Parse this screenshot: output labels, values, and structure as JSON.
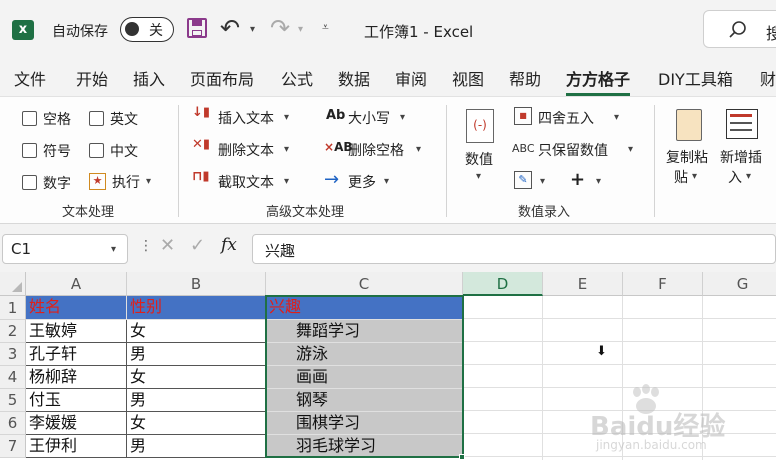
{
  "titlebar": {
    "autosave_label": "自动保存",
    "autosave_state": "关",
    "doc_title": "工作簿1 - Excel",
    "search_partial": "搜"
  },
  "tabs": [
    "文件",
    "开始",
    "插入",
    "页面布局",
    "公式",
    "数据",
    "审阅",
    "视图",
    "帮助",
    "方方格子",
    "DIY工具箱",
    "财"
  ],
  "active_tab": "方方格子",
  "ribbon": {
    "text_processing": {
      "checkboxes": [
        "空格",
        "英文",
        "符号",
        "中文",
        "数字"
      ],
      "execute_label": "执行",
      "group_label": "文本处理"
    },
    "advanced_text": {
      "insert_text": "插入文本",
      "delete_text": "删除文本",
      "extract_text": "截取文本",
      "case_label": "大小写",
      "case_icon_text": "Ab",
      "delete_space": "删除空格",
      "delete_space_icon_text": "AB",
      "more": "更多",
      "group_label": "高级文本处理"
    },
    "numeric": {
      "value_label": "数值",
      "round_label": "四舍五入",
      "keep_value_label": "只保留数值",
      "abc_icon_text": "ABC",
      "plus_label": "+",
      "group_label": "数值录入"
    },
    "extra": {
      "copy_paste_line1": "复制粘",
      "copy_paste_line2": "贴",
      "new_insert_line1": "新增插",
      "new_insert_line2": "入"
    }
  },
  "formula_bar": {
    "name_box": "C1",
    "fx_label": "fx",
    "content": "兴趣"
  },
  "sheet": {
    "columns": [
      "A",
      "B",
      "C",
      "D",
      "E",
      "F",
      "G"
    ],
    "row_numbers": [
      "1",
      "2",
      "3",
      "4",
      "5",
      "6",
      "7"
    ],
    "header_row": [
      "姓名",
      "性别",
      "兴趣"
    ],
    "rows": [
      [
        "王敏婷",
        "女",
        "舞蹈学习"
      ],
      [
        "孔子轩",
        "男",
        "游泳"
      ],
      [
        "杨柳辞",
        "女",
        "画画"
      ],
      [
        "付玉",
        "男",
        "钢琴"
      ],
      [
        "李媛媛",
        "女",
        "围棋学习"
      ],
      [
        "王伊利",
        "男",
        "羽毛球学习"
      ]
    ]
  },
  "colors": {
    "excel_green": "#1f7044",
    "header_fill": "#4472c4",
    "header_text": "#e0201a",
    "selection_fill": "#c8c8c8",
    "save_icon": "#8b3a8b"
  },
  "watermark": {
    "brand": "Baidu经验",
    "url": "jingyan.baidu.com"
  }
}
